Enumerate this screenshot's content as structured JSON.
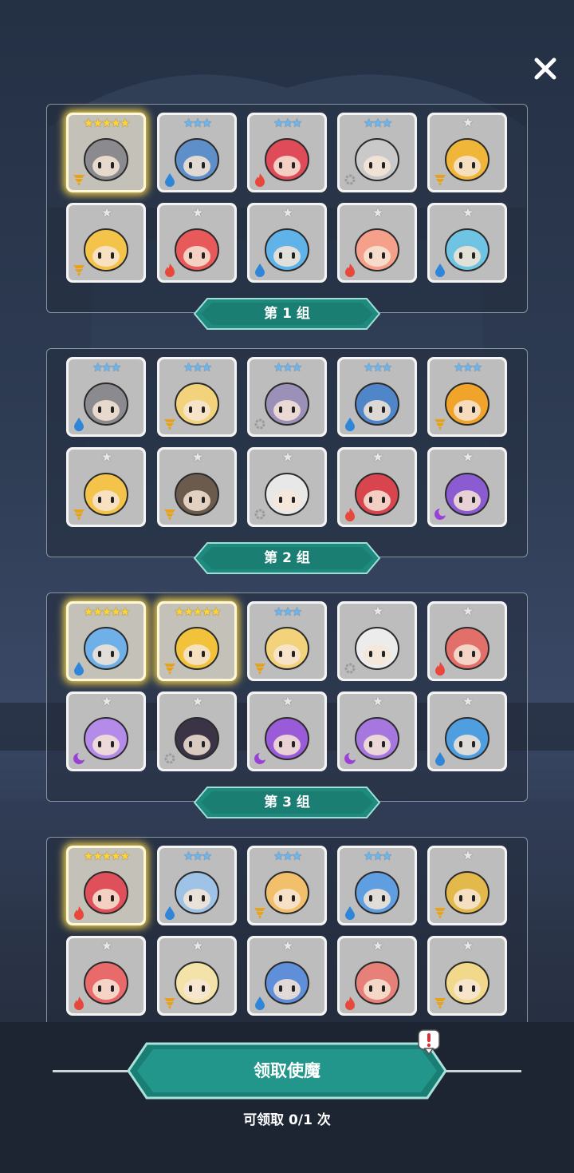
{
  "close_icon": "close-icon",
  "groups": [
    {
      "label": "第 1 组",
      "cards": [
        {
          "stars": 5,
          "element": "wind",
          "color": "#8a8a8f",
          "gold": true
        },
        {
          "stars": 3,
          "element": "water",
          "color": "#5f8fc9",
          "gold": false
        },
        {
          "stars": 3,
          "element": "fire",
          "color": "#e04b5a",
          "gold": false
        },
        {
          "stars": 3,
          "element": "light",
          "color": "#c9c9c9",
          "gold": false
        },
        {
          "stars": 1,
          "element": "wind",
          "color": "#f0b63a",
          "gold": false
        },
        {
          "stars": 1,
          "element": "wind",
          "color": "#f3c34a",
          "gold": false
        },
        {
          "stars": 1,
          "element": "fire",
          "color": "#e8595a",
          "gold": false
        },
        {
          "stars": 1,
          "element": "water",
          "color": "#5fb3e8",
          "gold": false
        },
        {
          "stars": 1,
          "element": "fire",
          "color": "#f5a08a",
          "gold": false
        },
        {
          "stars": 1,
          "element": "water",
          "color": "#6fc3e3",
          "gold": false
        }
      ]
    },
    {
      "label": "第 2 组",
      "cards": [
        {
          "stars": 3,
          "element": "water",
          "color": "#8a8a8f",
          "gold": false
        },
        {
          "stars": 3,
          "element": "wind",
          "color": "#f2d27a",
          "gold": false
        },
        {
          "stars": 3,
          "element": "light",
          "color": "#9a90b8",
          "gold": false
        },
        {
          "stars": 3,
          "element": "water",
          "color": "#4f85c9",
          "gold": false
        },
        {
          "stars": 3,
          "element": "wind",
          "color": "#f0a42a",
          "gold": false
        },
        {
          "stars": 1,
          "element": "wind",
          "color": "#f3c34a",
          "gold": false
        },
        {
          "stars": 1,
          "element": "wind",
          "color": "#6b5b4d",
          "gold": false
        },
        {
          "stars": 1,
          "element": "light",
          "color": "#e8e8e8",
          "gold": false
        },
        {
          "stars": 1,
          "element": "fire",
          "color": "#d9454f",
          "gold": false
        },
        {
          "stars": 1,
          "element": "dark",
          "color": "#8a5bd1",
          "gold": false
        }
      ]
    },
    {
      "label": "第 3 组",
      "cards": [
        {
          "stars": 5,
          "element": "water",
          "color": "#6fb0e8",
          "gold": true
        },
        {
          "stars": 5,
          "element": "wind",
          "color": "#f2c33a",
          "gold": true
        },
        {
          "stars": 3,
          "element": "wind",
          "color": "#f2d27a",
          "gold": false
        },
        {
          "stars": 1,
          "element": "light",
          "color": "#ececec",
          "gold": false
        },
        {
          "stars": 1,
          "element": "fire",
          "color": "#e26f6a",
          "gold": false
        },
        {
          "stars": 1,
          "element": "dark",
          "color": "#b48be8",
          "gold": false
        },
        {
          "stars": 1,
          "element": "light",
          "color": "#3b3346",
          "gold": false
        },
        {
          "stars": 1,
          "element": "dark",
          "color": "#9a5bd8",
          "gold": false
        },
        {
          "stars": 1,
          "element": "dark",
          "color": "#a777e0",
          "gold": false
        },
        {
          "stars": 1,
          "element": "water",
          "color": "#4f9fe0",
          "gold": false
        }
      ]
    },
    {
      "label": "",
      "cards": [
        {
          "stars": 5,
          "element": "fire",
          "color": "#e0505a",
          "gold": true
        },
        {
          "stars": 3,
          "element": "water",
          "color": "#9fc3e6",
          "gold": false
        },
        {
          "stars": 3,
          "element": "wind",
          "color": "#f2c06a",
          "gold": false
        },
        {
          "stars": 3,
          "element": "water",
          "color": "#5f9ee0",
          "gold": false
        },
        {
          "stars": 1,
          "element": "wind",
          "color": "#e2b94a",
          "gold": false
        },
        {
          "stars": 1,
          "element": "fire",
          "color": "#e86a6a",
          "gold": false
        },
        {
          "stars": 1,
          "element": "wind",
          "color": "#f3e3a8",
          "gold": false
        },
        {
          "stars": 1,
          "element": "water",
          "color": "#5f8fd9",
          "gold": false
        },
        {
          "stars": 1,
          "element": "fire",
          "color": "#e8807a",
          "gold": false
        },
        {
          "stars": 1,
          "element": "wind",
          "color": "#f2d88a",
          "gold": false
        }
      ]
    }
  ],
  "claim_button": {
    "label": "领取使魔"
  },
  "claim_count": "可领取 0/1 次",
  "colors": {
    "banner": "#1f8a7f",
    "banner_dark": "#156b62",
    "banner_border": "#9fe0d6",
    "fire": "#e8483b",
    "water": "#2f86d9",
    "wind": "#e8a21a",
    "light": "#9a9a9a",
    "dark": "#9b3fd6",
    "notice": "#d6323c"
  }
}
